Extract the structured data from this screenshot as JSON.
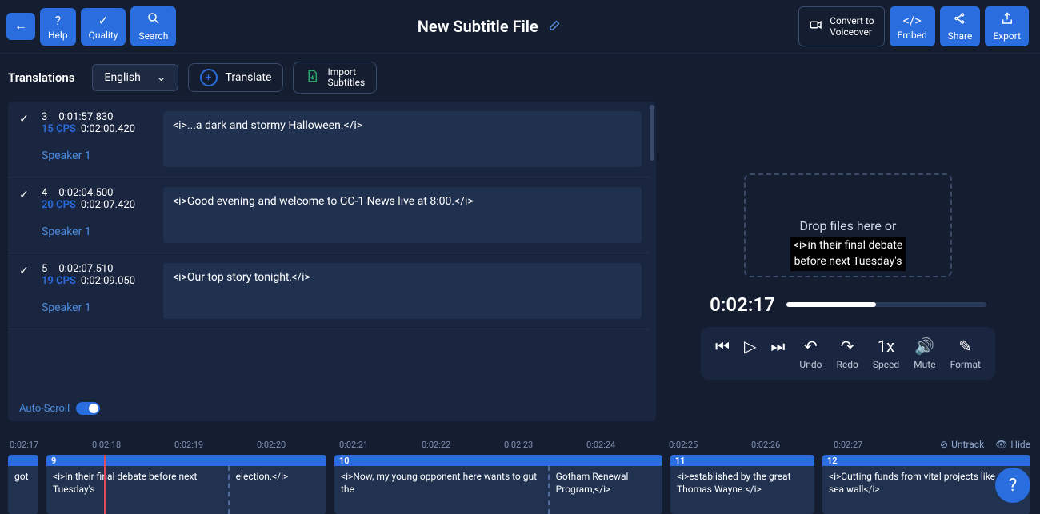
{
  "header": {
    "help": "Help",
    "quality": "Quality",
    "search": "Search",
    "title": "New Subtitle File",
    "convert_l1": "Convert to",
    "convert_l2": "Voiceover",
    "embed": "Embed",
    "share": "Share",
    "export": "Export"
  },
  "subheader": {
    "translations": "Translations",
    "language": "English",
    "translate": "Translate",
    "import_l1": "Import",
    "import_l2": "Subtitles"
  },
  "subtitles": [
    {
      "num": "3",
      "cps": "15 CPS",
      "t1": "0:01:57.830",
      "t2": "0:02:00.420",
      "speaker": "Speaker 1",
      "text": "<i>...a dark and stormy Halloween.</i>"
    },
    {
      "num": "4",
      "cps": "20 CPS",
      "t1": "0:02:04.500",
      "t2": "0:02:07.420",
      "speaker": "Speaker 1",
      "text": "<i>Good evening and welcome to GC-1 News live at 8:00.</i>"
    },
    {
      "num": "5",
      "cps": "19 CPS",
      "t1": "0:02:07.510",
      "t2": "0:02:09.050",
      "speaker": "Speaker 1",
      "text": "<i>Our top story tonight,</i>"
    }
  ],
  "auto_scroll_label": "Auto-Scroll",
  "preview": {
    "drop_text": "Drop files here or",
    "overlay_l1": "<i>in their final debate",
    "overlay_l2": "before next Tuesday's",
    "current_time": "0:02:17"
  },
  "controls": {
    "undo": "Undo",
    "redo": "Redo",
    "speed_val": "1x",
    "speed": "Speed",
    "mute": "Mute",
    "format": "Format"
  },
  "ruler": [
    "0:02:17",
    "0:02:18",
    "0:02:19",
    "0:02:20",
    "0:02:21",
    "0:02:22",
    "0:02:23",
    "0:02:24",
    "0:02:25",
    "0:02:26",
    "0:02:27"
  ],
  "ruler_actions": {
    "untrack": "Untrack",
    "hide": "Hide"
  },
  "clips": [
    {
      "head": "",
      "parts": [
        "got"
      ]
    },
    {
      "head": "9",
      "parts": [
        "<i>in their final debate before next Tuesday's",
        "election.</i>"
      ]
    },
    {
      "head": "10",
      "parts": [
        "<i>Now, my young opponent here wants to gut the",
        "Gotham Renewal Program,</i>"
      ]
    },
    {
      "head": "11",
      "parts": [
        "<i>established by the great Thomas Wayne.</i>"
      ]
    },
    {
      "head": "12",
      "parts": [
        "<i>Cutting funds from vital projects like our sea wall</i>"
      ]
    }
  ]
}
